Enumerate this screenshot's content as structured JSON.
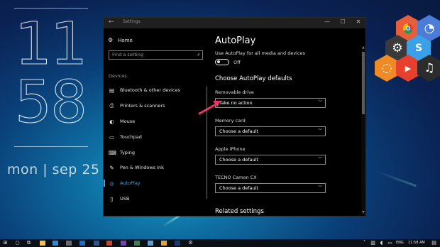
{
  "desktop": {
    "clock": {
      "hours": "11",
      "minutes": "58",
      "date": "mon | sep 25"
    }
  },
  "window": {
    "title": "Settings",
    "back_glyph": "←",
    "controls": {
      "minimize": "—",
      "maximize": "☐",
      "close": "✕"
    }
  },
  "sidebar": {
    "home_label": "Home",
    "search_placeholder": "Find a setting",
    "section_label": "Devices",
    "items": [
      {
        "label": "Bluetooth & other devices",
        "icon": "bluetooth-devices-icon",
        "glyph": "▤",
        "active": false
      },
      {
        "label": "Printers & scanners",
        "icon": "printer-icon",
        "glyph": "⎙",
        "active": false
      },
      {
        "label": "Mouse",
        "icon": "mouse-icon",
        "glyph": "◐",
        "active": false
      },
      {
        "label": "Touchpad",
        "icon": "touchpad-icon",
        "glyph": "▭",
        "active": false
      },
      {
        "label": "Typing",
        "icon": "keyboard-icon",
        "glyph": "⌨",
        "active": false
      },
      {
        "label": "Pen & Windows Ink",
        "icon": "pen-icon",
        "glyph": "✎",
        "active": false
      },
      {
        "label": "AutoPlay",
        "icon": "autoplay-icon",
        "glyph": "◎",
        "active": true
      },
      {
        "label": "USB",
        "icon": "usb-icon",
        "glyph": "▯",
        "active": false
      }
    ]
  },
  "content": {
    "page_title": "AutoPlay",
    "use_autoplay_label": "Use AutoPlay for all media and devices",
    "toggle_state": "Off",
    "defaults_heading": "Choose AutoPlay defaults",
    "settings": [
      {
        "label": "Removable drive",
        "value": "Take no action"
      },
      {
        "label": "Memory card",
        "value": "Choose a default"
      },
      {
        "label": "Apple iPhone",
        "value": "Choose a default"
      },
      {
        "label": "TECNO Camon CX",
        "value": "Choose a default"
      }
    ],
    "related_heading": "Related settings"
  },
  "taskbar": {
    "language": "ENG",
    "time": "11:58 AM"
  },
  "colors": {
    "accent": "#4aa3df",
    "annotation_arrow": "#e8336b",
    "window_bg": "#000000"
  }
}
